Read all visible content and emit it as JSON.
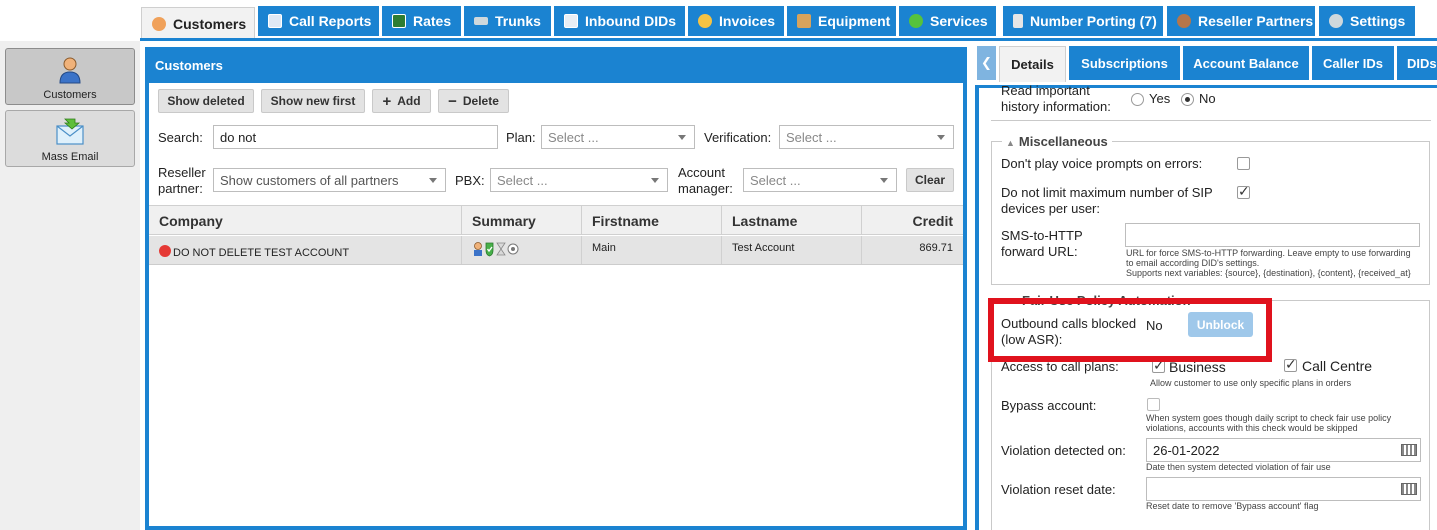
{
  "topnav": {
    "tabs": [
      {
        "label": "Customers",
        "icon": "user-icon"
      },
      {
        "label": "Call Reports",
        "icon": "report-icon"
      },
      {
        "label": "Rates",
        "icon": "chart-icon"
      },
      {
        "label": "Trunks",
        "icon": "trunk-icon"
      },
      {
        "label": "Inbound DIDs",
        "icon": "list-icon"
      },
      {
        "label": "Invoices",
        "icon": "coins-icon"
      },
      {
        "label": "Equipment",
        "icon": "box-icon"
      },
      {
        "label": "Services",
        "icon": "refresh-icon"
      },
      {
        "label": "Number Porting (7)",
        "icon": "phone-icon"
      },
      {
        "label": "Reseller Partners",
        "icon": "user-icon"
      },
      {
        "label": "Settings",
        "icon": "gear-icon"
      }
    ]
  },
  "sidebar": {
    "items": [
      {
        "label": "Customers",
        "icon": "user-icon"
      },
      {
        "label": "Mass Email",
        "icon": "email-icon"
      }
    ]
  },
  "customers": {
    "title": "Customers",
    "toolbar": {
      "show_deleted": "Show deleted",
      "show_new_first": "Show new first",
      "add": "Add",
      "delete": "Delete",
      "clear": "Clear"
    },
    "filters": {
      "search_label": "Search:",
      "search_value": "do not",
      "plan_label": "Plan:",
      "plan_value": "Select ...",
      "verification_label": "Verification:",
      "verification_value": "Select ...",
      "reseller_label_1": "Reseller",
      "reseller_label_2": "partner:",
      "reseller_value": "Show customers of all partners",
      "pbx_label": "PBX:",
      "pbx_value": "Select ...",
      "account_manager_label_1": "Account",
      "account_manager_label_2": "manager:",
      "account_manager_value": "Select ..."
    },
    "columns": [
      "Company",
      "Summary",
      "Firstname",
      "Lastname",
      "Credit"
    ],
    "rows": [
      {
        "company": "DO NOT DELETE TEST ACCOUNT",
        "firstname": "Main",
        "lastname": "Test Account",
        "credit": "869.71"
      }
    ]
  },
  "details": {
    "tabs": [
      "Details",
      "Subscriptions",
      "Account Balance",
      "Caller IDs",
      "DIDs"
    ],
    "read_history_label_1": "Read important",
    "read_history_label_2": "history information:",
    "yes": "Yes",
    "no": "No",
    "misc_legend": "Miscellaneous",
    "voice_prompts_label": "Don't play voice prompts on errors:",
    "sip_limit_label_1": "Do not limit maximum number of SIP",
    "sip_limit_label_2": "devices per user:",
    "sms_label_1": "SMS-to-HTTP",
    "sms_label_2": "forward URL:",
    "sms_hint_1": "URL for force SMS-to-HTTP forwarding. Leave empty to use forwarding",
    "sms_hint_2": "to email according DID's settings.",
    "sms_hint_3": "Supports next variables: {source}, {destination}, {content}, {received_at}",
    "fup_legend": "Fair Use Policy Automation",
    "outbound_blocked_label_1": "Outbound calls blocked",
    "outbound_blocked_label_2": "(low ASR):",
    "outbound_blocked_value": "No",
    "unblock": "Unblock",
    "call_plans_label": "Access to call plans:",
    "plan_business": "Business",
    "plan_call_centre": "Call Centre",
    "call_plans_hint": "Allow customer to use only specific plans in orders",
    "bypass_label": "Bypass account:",
    "bypass_hint_1": "When system goes though daily script to check fair use policy",
    "bypass_hint_2": "violations, accounts with this check would be skipped",
    "violation_detected_label": "Violation detected on:",
    "violation_detected_value": "26-01-2022",
    "violation_detected_hint": "Date then system detected violation of fair use",
    "violation_reset_label": "Violation reset date:",
    "violation_reset_hint": "Reset date to remove 'Bypass account' flag"
  },
  "colors": {
    "accent": "#1b83d1",
    "highlight": "#e0121d",
    "status_red": "#e53935"
  }
}
